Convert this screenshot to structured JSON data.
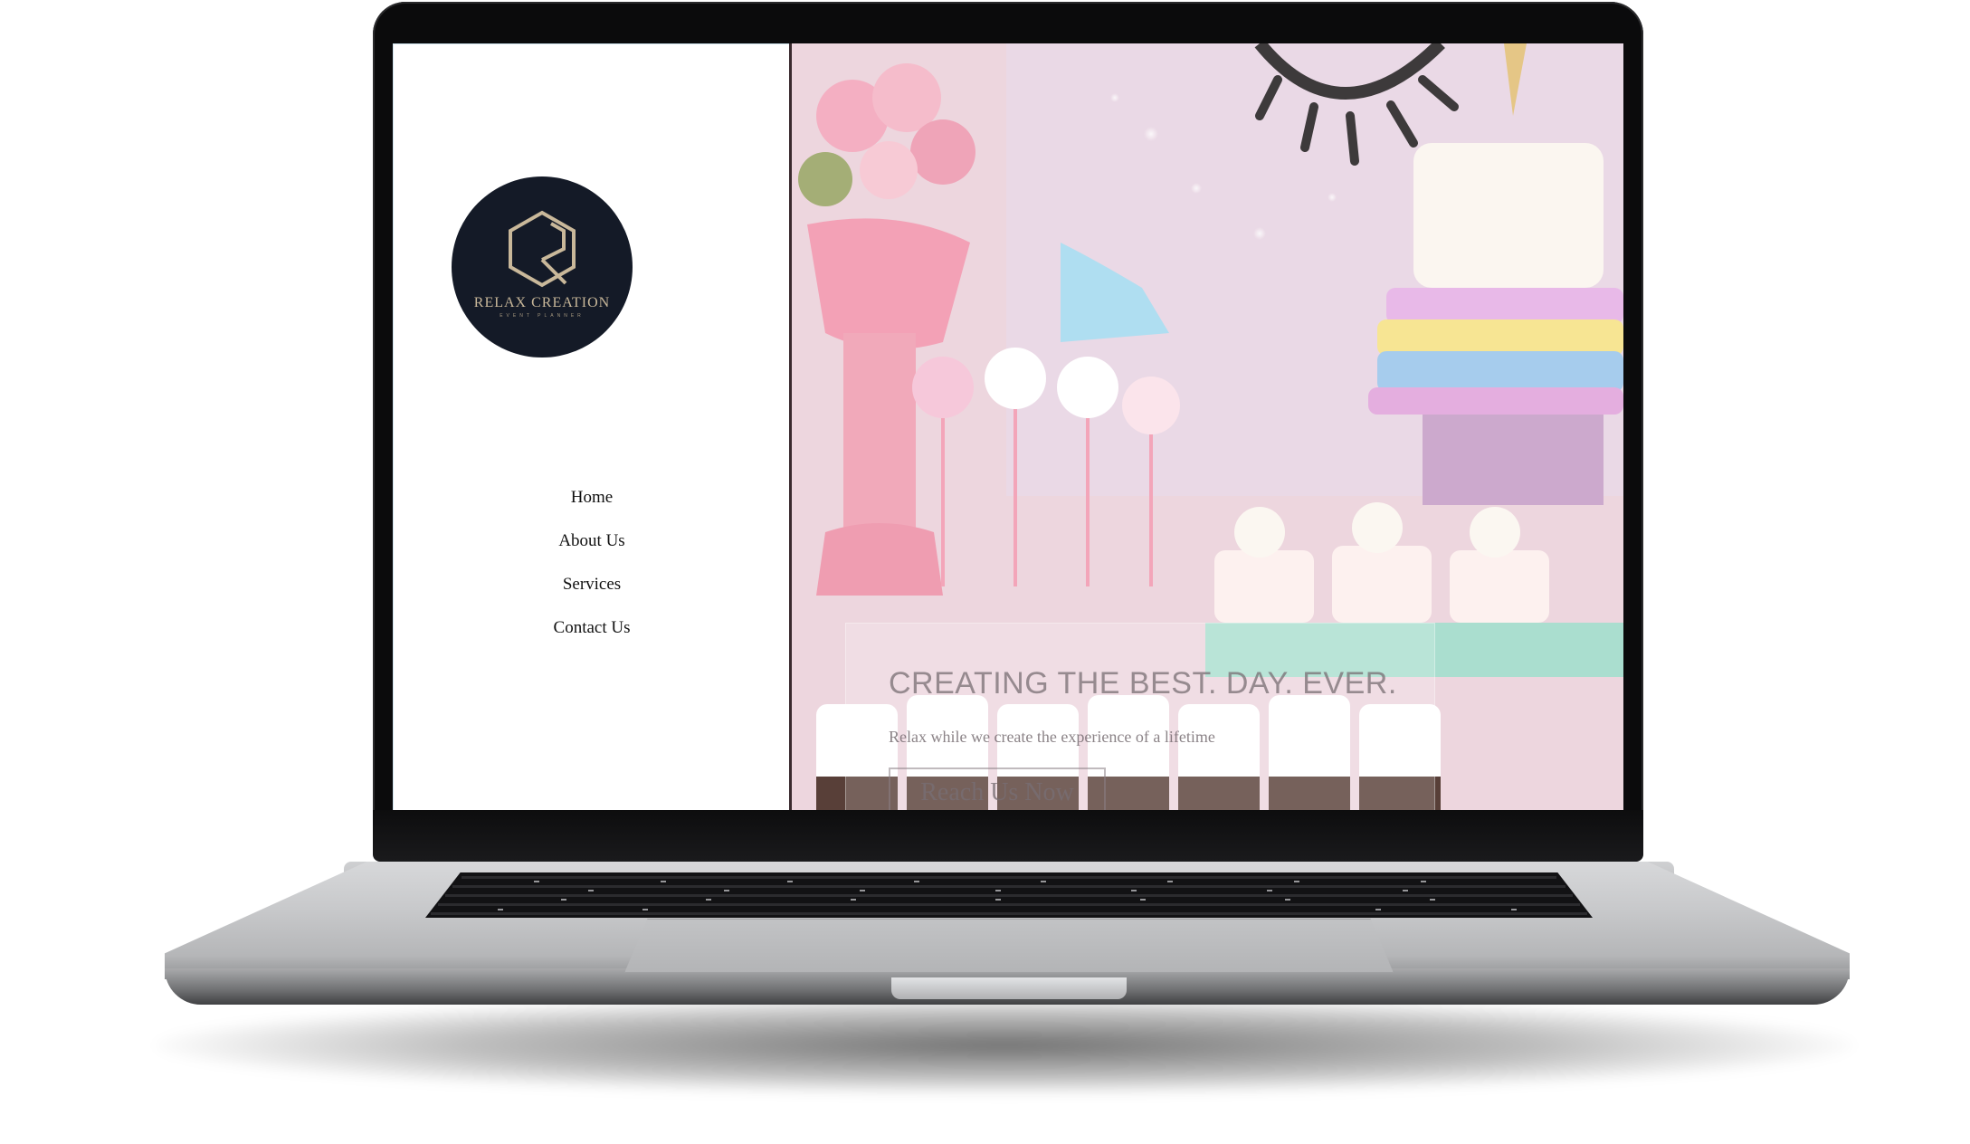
{
  "logo": {
    "name": "RELAX CREATION",
    "tagline": "EVENT PLANNER"
  },
  "nav": {
    "items": [
      {
        "label": "Home"
      },
      {
        "label": "About Us"
      },
      {
        "label": "Services"
      },
      {
        "label": "Contact Us"
      }
    ]
  },
  "hero": {
    "title": "CREATING THE BEST. DAY. EVER.",
    "subtitle": "Relax while we create the experience of a lifetime",
    "cta_label": "Reach Us Now"
  },
  "colors": {
    "logo_bg": "#141a27",
    "logo_gold": "#c9b89a",
    "hero_pink": "#ead0da",
    "laptop_body": "#c8c9cb"
  },
  "icons": {
    "logo_mark": "rc-monogram-icon"
  }
}
